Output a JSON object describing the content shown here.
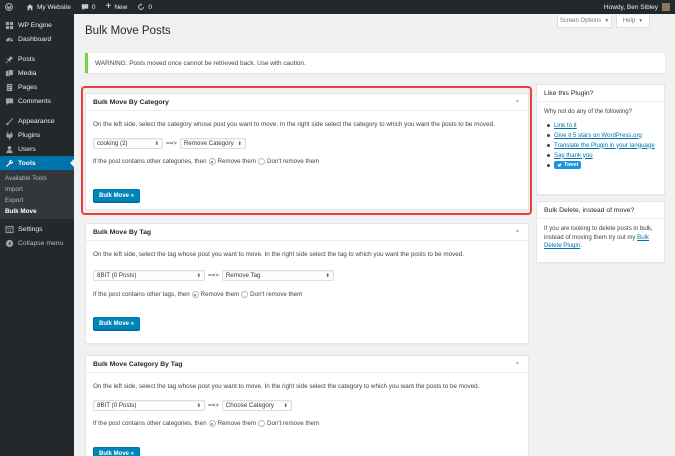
{
  "adminbar": {
    "site_name": "My Website",
    "comments_count": "0",
    "new_label": "New",
    "updates_count": "0",
    "howdy": "Howdy, Ben Sibley"
  },
  "sidebar": {
    "items": [
      {
        "label": "WP Engine",
        "icon": "wp-engine-icon"
      },
      {
        "label": "Dashboard",
        "icon": "dashboard-icon"
      },
      {
        "label": "Posts",
        "icon": "pin-icon"
      },
      {
        "label": "Media",
        "icon": "media-icon"
      },
      {
        "label": "Pages",
        "icon": "pages-icon"
      },
      {
        "label": "Comments",
        "icon": "comment-icon"
      },
      {
        "label": "Appearance",
        "icon": "brush-icon"
      },
      {
        "label": "Plugins",
        "icon": "plugin-icon"
      },
      {
        "label": "Users",
        "icon": "user-icon"
      },
      {
        "label": "Tools",
        "icon": "wrench-icon"
      }
    ],
    "submenu": [
      "Available Tools",
      "Import",
      "Export",
      "Bulk Move"
    ],
    "after": [
      {
        "label": "Settings",
        "icon": "settings-icon"
      },
      {
        "label": "Collapse menu",
        "icon": "collapse-icon"
      }
    ]
  },
  "header": {
    "title": "Bulk Move Posts",
    "screen_options": "Screen Options",
    "help": "Help"
  },
  "notice": "WARNING: Posts moved once cannot be retrieved back. Use with caution.",
  "boxes": {
    "category": {
      "title": "Bulk Move By Category",
      "description": "On the left side, select the category whose post you want to move. In the right side select the category to which you want the posts to be moved.",
      "from_value": "cooking  (2)",
      "arrow": "==>",
      "to_value": "Remove Category",
      "radio_label": "If the post contains other categories, then",
      "opt_remove": "Remove them",
      "opt_keep": "Don't remove them",
      "button": "Bulk Move »"
    },
    "tag": {
      "title": "Bulk Move By Tag",
      "description": "On the left side, select the tag whose post you want to move. In the right side select the tag to which you want the posts to be moved.",
      "from_value": "8BIT (0 Posts)",
      "arrow": "==>",
      "to_value": "Remove Tag",
      "radio_label": "If the post contains other tags, then",
      "opt_remove": "Remove them",
      "opt_keep": "Don't remove them",
      "button": "Bulk Move »"
    },
    "category_by_tag": {
      "title": "Bulk Move Category By Tag",
      "description": "On the left side, select the tag whose post you want to move. In the right side select the category to which you want the posts to be moved.",
      "from_value": "8BIT (0 Posts)",
      "arrow": "==>",
      "to_value": "Choose Category",
      "radio_label": "If the post contains other categories, then",
      "opt_remove": "Remove them",
      "opt_keep": "Don't remove them",
      "button": "Bulk Move »"
    }
  },
  "side": {
    "like": {
      "title": "Like this Plugin?",
      "intro": "Why not do any of the following?",
      "links": [
        "Link to it",
        "Give it 5 stars on WordPress.org",
        "Translate the Plugin in your language",
        "Say thank you"
      ],
      "tweet": "Tweet"
    },
    "delete": {
      "title": "Bulk Delete, instead of move?",
      "text": "If you are looking to delete posts in bulk, instead of moving them try out my",
      "link": "Bulk Delete Plugin",
      "end": "."
    }
  },
  "colors": {
    "admin_bg": "#23282d",
    "accent": "#0073aa",
    "primary_button": "#0085ba",
    "highlight": "#e8413b",
    "notice_border": "#7ad03a"
  }
}
